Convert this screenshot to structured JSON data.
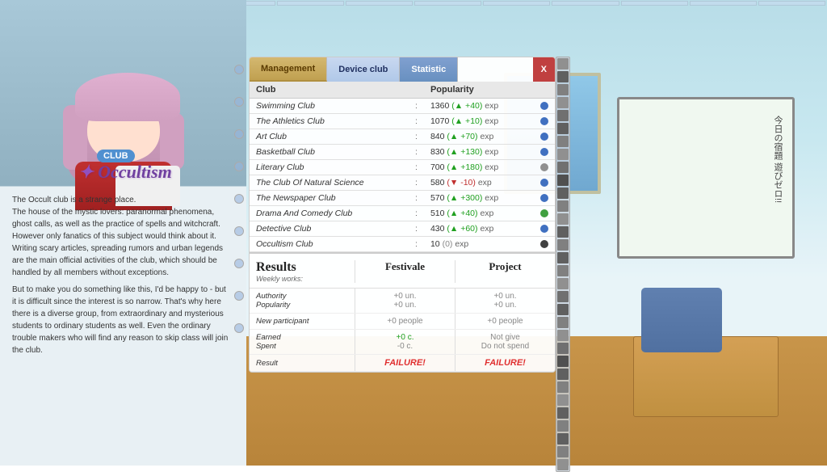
{
  "background": {
    "ceiling_color": "#b8d8e8",
    "wall_color": "#e0eef4",
    "floor_color": "#c89050"
  },
  "tabs": {
    "management": "Management",
    "device_club": "Device club",
    "statistic": "Statistic",
    "close": "X"
  },
  "table": {
    "headers": {
      "club": "Club",
      "colon": ":",
      "popularity": "Popularity"
    },
    "rows": [
      {
        "name": "Swimming club",
        "popularity": "1360",
        "change": "+40",
        "direction": "up",
        "unit": "exp",
        "dot": "blue"
      },
      {
        "name": "The athletics club",
        "popularity": "1070",
        "change": "+10",
        "direction": "up",
        "unit": "exp",
        "dot": "blue"
      },
      {
        "name": "Art club",
        "popularity": "840",
        "change": "+70",
        "direction": "up",
        "unit": "exp",
        "dot": "blue"
      },
      {
        "name": "Basketball club",
        "popularity": "830",
        "change": "+130",
        "direction": "up",
        "unit": "exp",
        "dot": "blue"
      },
      {
        "name": "Literary club",
        "popularity": "700",
        "change": "+180",
        "direction": "up",
        "unit": "exp",
        "dot": "gray"
      },
      {
        "name": "The club of natural science",
        "popularity": "580",
        "change": "-10",
        "direction": "down",
        "unit": "exp",
        "dot": "blue"
      },
      {
        "name": "The newspaper club",
        "popularity": "570",
        "change": "+300",
        "direction": "up",
        "unit": "exp",
        "dot": "blue"
      },
      {
        "name": "Drama and Comedy club",
        "popularity": "510",
        "change": "+40",
        "direction": "up",
        "unit": "exp",
        "dot": "green"
      },
      {
        "name": "Detective club",
        "popularity": "430",
        "change": "+60",
        "direction": "up",
        "unit": "exp",
        "dot": "blue"
      },
      {
        "name": "Occultism club",
        "popularity": "10",
        "change": "0",
        "direction": "neutral",
        "unit": "exp",
        "dot": "dark"
      }
    ]
  },
  "results": {
    "title": "Results",
    "subtitle": "Weekly works:",
    "col1_header": "Festivale",
    "col2_header": "Project",
    "rows": [
      {
        "label": "Authority\nPopularity",
        "col1_line1": "+0 un.",
        "col1_line2": "+0 un.",
        "col2_line1": "+0 un.",
        "col2_line2": "+0 un."
      },
      {
        "label": "New participant",
        "col1": "+0 people",
        "col2": "+0 people"
      },
      {
        "label": "Earned\nSpent",
        "col1_line1": "+0 c.",
        "col1_line2": "-0 c.",
        "col2_line1": "Not give",
        "col2_line2": "Do not spend"
      },
      {
        "label": "Result",
        "col1": "FAILURE!",
        "col2": "FAILURE!"
      }
    ]
  },
  "character": {
    "club_label": "CLUB",
    "name": "Occultism"
  },
  "description": {
    "text": "The Occult club is a strange place.\nThe house of the mystic lovers: paranormal phenomena, ghost calls, as well as the practice of spells and witchcraft. However only fanatics of this subject would think about it. Writing scary articles, spreading rumors and urban legends are the main official activities of the club, which should be handled by all members without exceptions.\n\nBut to make you do something like this, I'd be happy to - but it is difficult since the interest is so narrow. That's why here there is a diverse group, from extraordinary and mysterious students to ordinary students as well. Even the ordinary trouble makers who will find any reason to skip class will join the club."
  },
  "whiteboard_text": "今日の宿題 遊びゼロ!!"
}
